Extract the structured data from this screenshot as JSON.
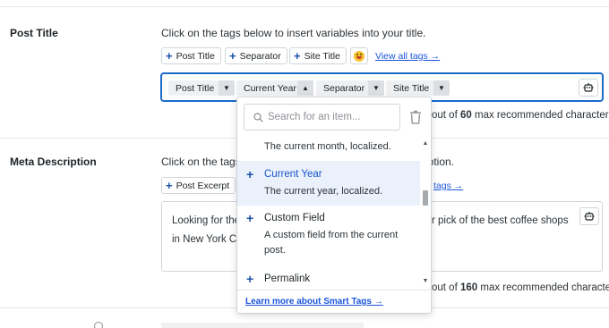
{
  "post_title": {
    "label": "Post Title",
    "help": "Click on the tags below to insert variables into your title.",
    "tag_buttons": [
      "Post Title",
      "Separator",
      "Site Title"
    ],
    "view_all": "View all tags →",
    "chips": [
      "Post Title",
      "Current Year",
      "Separator",
      "Site Title"
    ],
    "counter_suffix": "out of",
    "counter_max": "60",
    "counter_tail": "max recommended characters."
  },
  "meta_description": {
    "label": "Meta Description",
    "help_start": "Click on the tags",
    "help_end": "cription.",
    "tag_button": "Post Excerpt",
    "view_all_partial": "tags →",
    "text_line1_start": "Looking for the",
    "text_line1_end": "r pick of the best coffee shops",
    "text_line2_start": "in New York Cit",
    "counter_suffix": "out of",
    "counter_max": "160",
    "counter_tail": "max recommended characters."
  },
  "dropdown": {
    "search_placeholder": "Search for an item...",
    "items": [
      {
        "name": "",
        "desc": "The current month, localized."
      },
      {
        "name": "Current Year",
        "desc": "The current year, localized."
      },
      {
        "name": "Custom Field",
        "desc": "A custom field from the current",
        "desc2": "post."
      },
      {
        "name": "Permalink",
        "desc": ""
      }
    ],
    "footer_link": "Learn more about Smart Tags →"
  },
  "colors": {
    "accent": "#1a56db",
    "focus_border": "#1a6ac9",
    "active_item_bg": "#eaf1fb"
  }
}
